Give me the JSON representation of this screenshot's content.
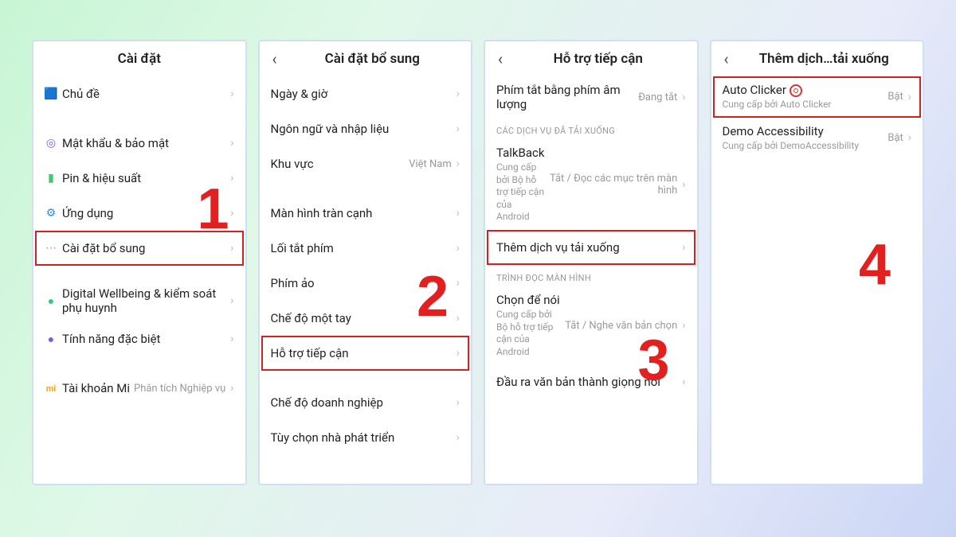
{
  "step_numbers": [
    "1",
    "2",
    "3",
    "4"
  ],
  "panel1": {
    "title": "Cài đặt",
    "items": [
      {
        "label": "Chủ đề",
        "icon": "🟦",
        "color": "#3aa0ff"
      },
      {
        "gap": true
      },
      {
        "label": "Mật khẩu & bảo mật",
        "icon": "◎",
        "color": "#7a5cff"
      },
      {
        "label": "Pin & hiệu suất",
        "icon": "▮",
        "color": "#3cc96a"
      },
      {
        "label": "Ứng dụng",
        "icon": "⚙",
        "color": "#2f8af5"
      },
      {
        "label": "Cài đặt bổ sung",
        "icon": "⋯",
        "color": "#8a8aff",
        "highlight": true
      },
      {
        "gap": true
      },
      {
        "label": "Digital Wellbeing & kiểm soát phụ huynh",
        "icon": "●",
        "color": "#39c979"
      },
      {
        "label": "Tính năng đặc biệt",
        "icon": "●",
        "color": "#8060d8"
      },
      {
        "gap": true
      },
      {
        "label": "Tài khoản Mi",
        "icon": "mi",
        "color": "#f5a623",
        "value": "Phân tích Nghiệp vụ"
      }
    ]
  },
  "panel2": {
    "title": "Cài đặt bổ sung",
    "items": [
      {
        "label": "Ngày & giờ"
      },
      {
        "label": "Ngôn ngữ và nhập liệu"
      },
      {
        "label": "Khu vực",
        "value": "Việt Nam"
      },
      {
        "gap": true
      },
      {
        "label": "Màn hình tràn cạnh"
      },
      {
        "label": "Lối tắt phím"
      },
      {
        "label": "Phím ảo"
      },
      {
        "label": "Chế độ một tay"
      },
      {
        "label": "Hỗ trợ tiếp cận",
        "highlight": true
      },
      {
        "gap": true
      },
      {
        "label": "Chế độ doanh nghiệp"
      },
      {
        "label": "Tùy chọn nhà phát triển"
      }
    ]
  },
  "panel3": {
    "title": "Hỗ trợ tiếp cận",
    "sections": [
      {
        "items": [
          {
            "label": "Phím tắt bằng phím âm lượng",
            "value": "Đang tắt"
          }
        ]
      },
      {
        "header": "CÁC DỊCH VỤ ĐÃ TẢI XUỐNG",
        "items": [
          {
            "label": "TalkBack",
            "sub": "Cung cấp bởi Bộ hỗ trợ tiếp cận của Android",
            "value": "Tắt / Đọc các mục trên màn hình"
          },
          {
            "label": "Thêm dịch vụ tải xuống",
            "highlight": true
          }
        ]
      },
      {
        "header": "TRÌNH ĐỌC MÀN HÌNH",
        "items": [
          {
            "label": "Chọn để nói",
            "sub": "Cung cấp bởi Bộ hỗ trợ tiếp cận của Android",
            "value": "Tắt / Nghe văn bản chọn"
          },
          {
            "label": "Đầu ra văn bản thành giọng nói"
          }
        ]
      }
    ]
  },
  "panel4": {
    "title": "Thêm dịch…tải xuống",
    "items": [
      {
        "label": "Auto Clicker",
        "sub": "Cung cấp bởi Auto Clicker",
        "value": "Bật",
        "target": true,
        "highlight": true
      },
      {
        "label": "Demo Accessibility",
        "sub": "Cung cấp bởi DemoAccessibility",
        "value": "Bật"
      }
    ]
  }
}
